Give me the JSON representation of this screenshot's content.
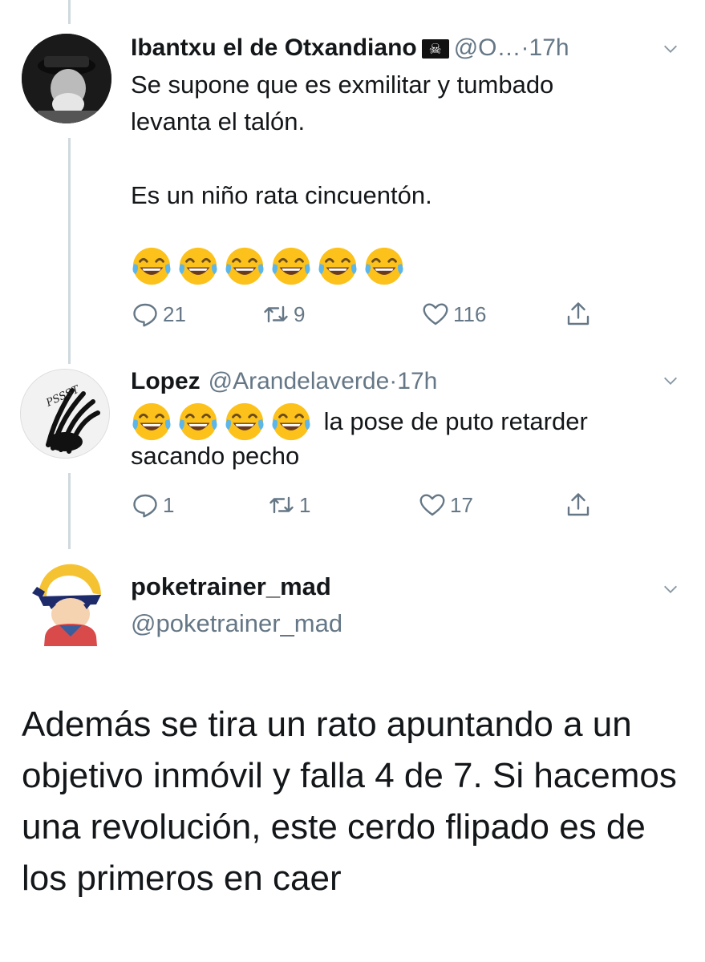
{
  "tweets": [
    {
      "display_name": "Ibantxu el de Otxandiano",
      "flag": "☠",
      "handle": "@O…",
      "separator": "·",
      "time": "17h",
      "text": "Se supone que es exmilitar y tumbado\nlevanta el talón.\n\nEs un niño rata cincuentón.",
      "emoji_count": 6,
      "replies": "21",
      "retweets": "9",
      "likes": "116"
    },
    {
      "display_name": "Lopez",
      "handle": "@Arandelaverde",
      "separator": "·",
      "time": "17h",
      "text_after_emoji": "la pose de puto retarder",
      "text_line2": "sacando pecho",
      "emoji_count": 4,
      "replies": "1",
      "retweets": "1",
      "likes": "17",
      "avatar_text": "PSSST"
    }
  ],
  "main_tweet": {
    "display_name": "poketrainer_mad",
    "handle": "@poketrainer_mad",
    "text": "Además se tira un rato apuntando a un objetivo inmóvil y falla 4 de 7. Si hacemos una revolución, este cerdo flipado es de los primeros en caer"
  },
  "colors": {
    "text": "#14171a",
    "secondary": "#657786",
    "thread_line": "#cfd9de",
    "emoji_face": "#fcc21b"
  },
  "icons": [
    "reply-icon",
    "retweet-icon",
    "like-icon",
    "share-icon",
    "chevron-down-icon",
    "laughing-emoji-icon"
  ]
}
